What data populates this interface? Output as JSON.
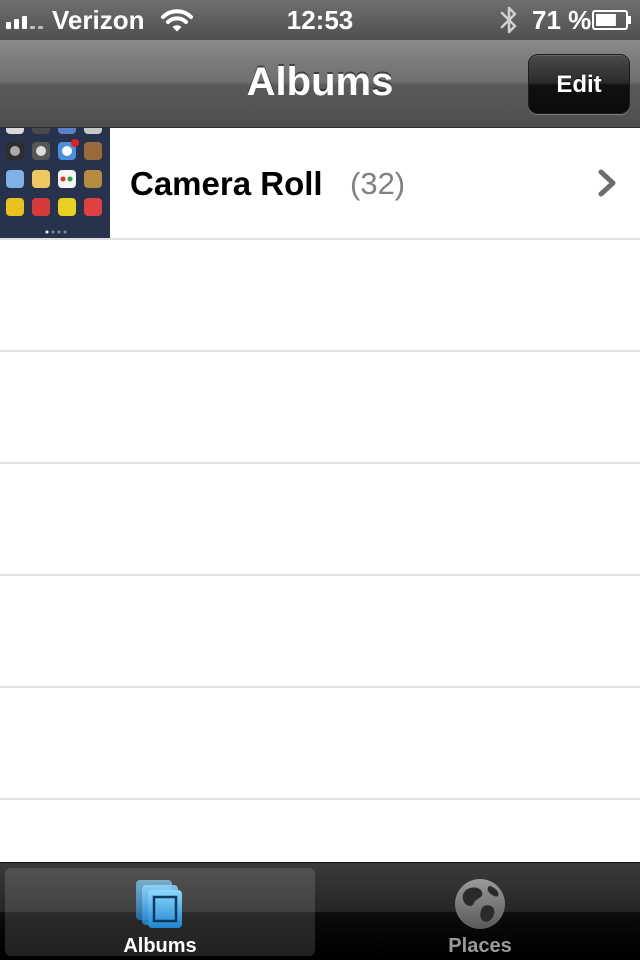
{
  "status_bar": {
    "carrier": "Verizon",
    "time": "12:53",
    "battery_percent": "71 %",
    "battery_level": 0.71,
    "signal_bars": 3
  },
  "nav_bar": {
    "title": "Albums",
    "edit_label": "Edit"
  },
  "albums": [
    {
      "name": "Camera Roll",
      "count": "(32)",
      "icon": "chevron-right-icon"
    }
  ],
  "tab_bar": {
    "tabs": [
      {
        "label": "Albums",
        "icon": "albums-icon",
        "selected": true
      },
      {
        "label": "Places",
        "icon": "globe-icon",
        "selected": false
      }
    ]
  },
  "colors": {
    "nav_bar": "#6e6e6e",
    "tab_active_icon": "#4fb3e8",
    "count_text": "#808080",
    "separator": "#e0e0e0"
  }
}
